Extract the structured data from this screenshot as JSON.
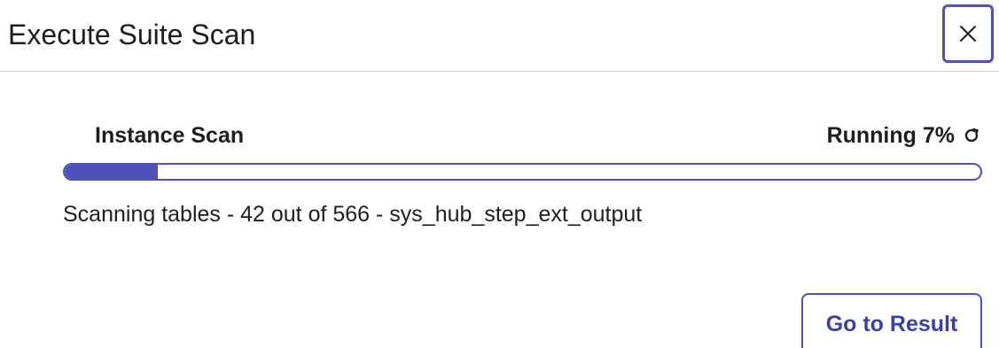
{
  "modal": {
    "title": "Execute Suite Scan",
    "close_icon": "close-icon"
  },
  "scan": {
    "label": "Instance Scan",
    "status_text": "Running 7%",
    "status_icon": "refresh-icon",
    "progress_percent": 7,
    "details": "Scanning tables - 42 out of 566 - sys_hub_step_ext_output"
  },
  "footer": {
    "go_to_result_label": "Go to Result"
  },
  "colors": {
    "accent": "#4f52bd",
    "text": "#1d1d22",
    "divider": "#c9ccd6"
  }
}
